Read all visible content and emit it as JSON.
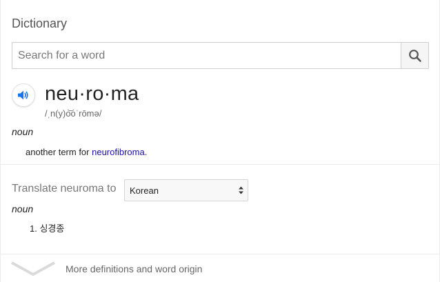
{
  "header": {
    "title": "Dictionary"
  },
  "search": {
    "placeholder": "Search for a word",
    "value": "",
    "button_icon": "search-icon"
  },
  "entry": {
    "audio_icon": "speaker-icon",
    "headword": "neu·ro·ma",
    "phonetic": "/ˌn(y)o͝oˈrōmə/",
    "part_of_speech": "noun",
    "definition_prefix": "another term for ",
    "definition_link": "neurofibroma",
    "definition_suffix": "."
  },
  "translate": {
    "label": "Translate neuroma to",
    "selected_language": "Korean",
    "part_of_speech": "noun",
    "items": [
      {
        "number": "1.",
        "text": "싱경종"
      }
    ]
  },
  "footer": {
    "expand_icon": "chevron-down-icon",
    "more_label": "More definitions and word origin"
  },
  "colors": {
    "link": "#1a0dab",
    "audio_icon": "#1a73e8",
    "muted_text": "#777777"
  }
}
